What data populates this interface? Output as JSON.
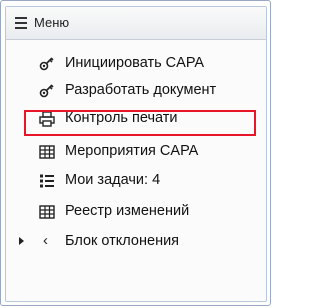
{
  "menu": {
    "title": "Меню",
    "items": [
      {
        "label": "Инициировать CAPA",
        "icon": "gear-key-icon"
      },
      {
        "label": "Разработать документ",
        "icon": "gear-key-icon"
      },
      {
        "label": "Контроль печати",
        "icon": "printer-icon",
        "highlighted": true
      },
      {
        "label": "Мероприятия CAPA",
        "icon": "table-grid-icon"
      },
      {
        "label": "Мои задачи: 4",
        "icon": "task-list-icon"
      },
      {
        "label": "Реестр изменений",
        "icon": "table-grid-icon"
      },
      {
        "label": "Блок отклонения",
        "icon": "chevron-left-icon",
        "collapsed": true
      }
    ]
  },
  "colors": {
    "highlight_border": "#e8142a",
    "frame_border": "#9aa7c2"
  }
}
